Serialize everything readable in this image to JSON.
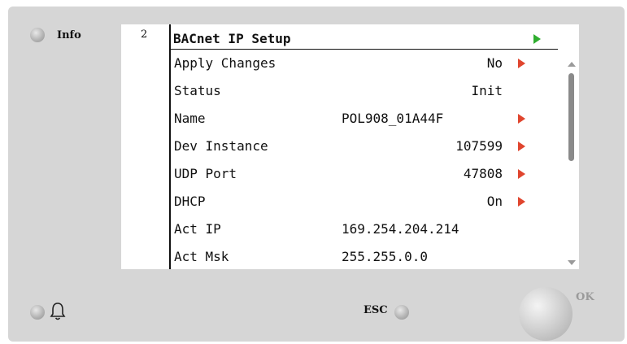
{
  "colors": {
    "panel": "#d6d6d6",
    "arrow_edit": "#e0452e",
    "arrow_enter": "#2fae2f"
  },
  "info_label": "Info",
  "page_number": "2",
  "screen": {
    "title": "BACnet IP Setup",
    "rows": [
      {
        "label": "Apply Changes",
        "value": "No",
        "editable": true
      },
      {
        "label": "Status",
        "value": "Init",
        "editable": false
      },
      {
        "label": "Name",
        "value": "POL908_01A44F",
        "editable": true
      },
      {
        "label": "Dev Instance",
        "value": "107599",
        "editable": true
      },
      {
        "label": "UDP Port",
        "value": "47808",
        "editable": true
      },
      {
        "label": "DHCP",
        "value": "On",
        "editable": true
      },
      {
        "label": "Act IP",
        "value": "169.254.204.214",
        "editable": false
      },
      {
        "label": "Act Msk",
        "value": "255.255.0.0",
        "editable": false
      }
    ]
  },
  "buttons": {
    "esc_label": "ESC",
    "ok_label": "OK"
  },
  "icons": {
    "alarm": "bell-icon"
  }
}
